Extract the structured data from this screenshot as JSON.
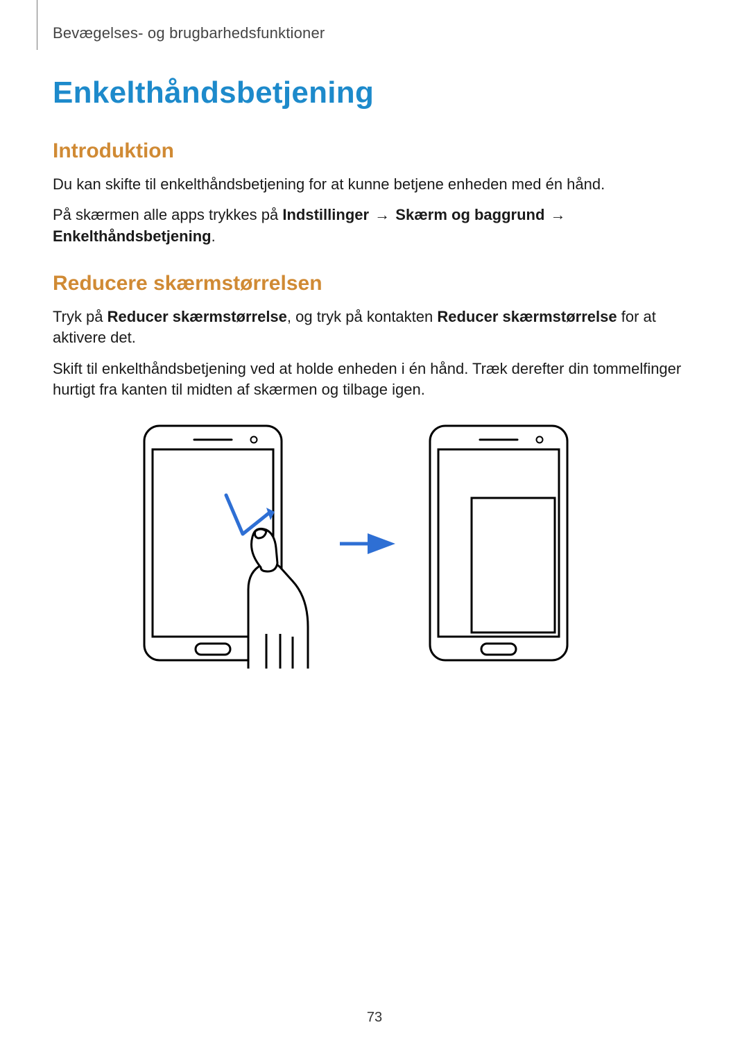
{
  "header": "Bevægelses- og brugbarhedsfunktioner",
  "title": "Enkelthåndsbetjening",
  "s1": {
    "heading": "Introduktion",
    "p1": "Du kan skifte til enkelthåndsbetjening for at kunne betjene enheden med én hånd.",
    "p2_before": "På skærmen alle apps trykkes på ",
    "p2_b1": "Indstillinger",
    "arrow": " → ",
    "p2_b2": "Skærm og baggrund",
    "p2_b3": "Enkelthåndsbetjening",
    "period": "."
  },
  "s2": {
    "heading": "Reducere skærmstørrelsen",
    "p1_a": "Tryk på ",
    "p1_b1": "Reducer skærmstørrelse",
    "p1_mid": ", og tryk på kontakten ",
    "p1_b2": "Reducer skærmstørrelse",
    "p1_end": " for at aktivere det.",
    "p2": "Skift til enkelthåndsbetjening ved at holde enheden i én hånd. Træk derefter din tommelfinger hurtigt fra kanten til midten af skærmen og tilbage igen."
  },
  "page_number": "73"
}
